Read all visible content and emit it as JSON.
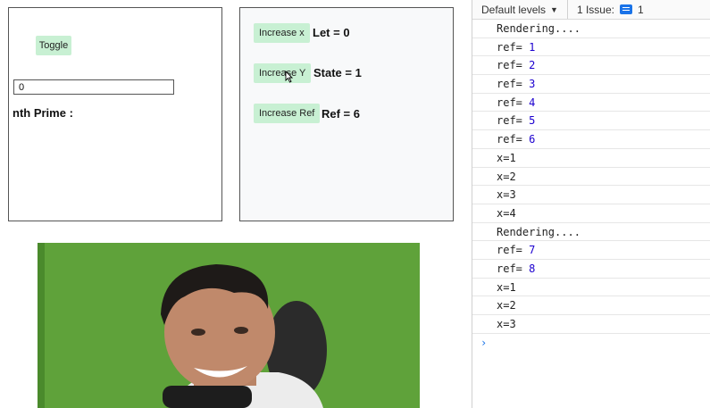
{
  "left_panel": {
    "toggle_label": "Toggle",
    "input_value": "0",
    "nth_prime_label": "nth Prime :"
  },
  "right_panel": {
    "increase_x_label": "Increase x",
    "let_text": "Let = 0",
    "increase_y_label": "Increase Y",
    "state_text": "State = 1",
    "increase_ref_label": "Increase Ref",
    "ref_text": "Ref = 6"
  },
  "devtools": {
    "levels_label": "Default levels",
    "issues_label": "1 Issue:",
    "issues_count": "1",
    "log": [
      {
        "text": "Rendering....",
        "num": ""
      },
      {
        "text": "ref= ",
        "num": "1"
      },
      {
        "text": "ref= ",
        "num": "2"
      },
      {
        "text": "ref= ",
        "num": "3"
      },
      {
        "text": "ref= ",
        "num": "4"
      },
      {
        "text": "ref= ",
        "num": "5"
      },
      {
        "text": "ref= ",
        "num": "6"
      },
      {
        "text": "x=1",
        "num": ""
      },
      {
        "text": "x=2",
        "num": ""
      },
      {
        "text": "x=3",
        "num": ""
      },
      {
        "text": "x=4",
        "num": ""
      },
      {
        "text": "Rendering....",
        "num": ""
      },
      {
        "text": "ref= ",
        "num": "7"
      },
      {
        "text": "ref= ",
        "num": "8"
      },
      {
        "text": "x=1",
        "num": ""
      },
      {
        "text": "x=2",
        "num": ""
      },
      {
        "text": "x=3",
        "num": ""
      }
    ],
    "prompt": "›"
  },
  "colors": {
    "button_bg": "#c8f0d3",
    "video_bg": "#5fa23a",
    "log_number": "#1c00cf",
    "issue_blue": "#1a73e8"
  }
}
